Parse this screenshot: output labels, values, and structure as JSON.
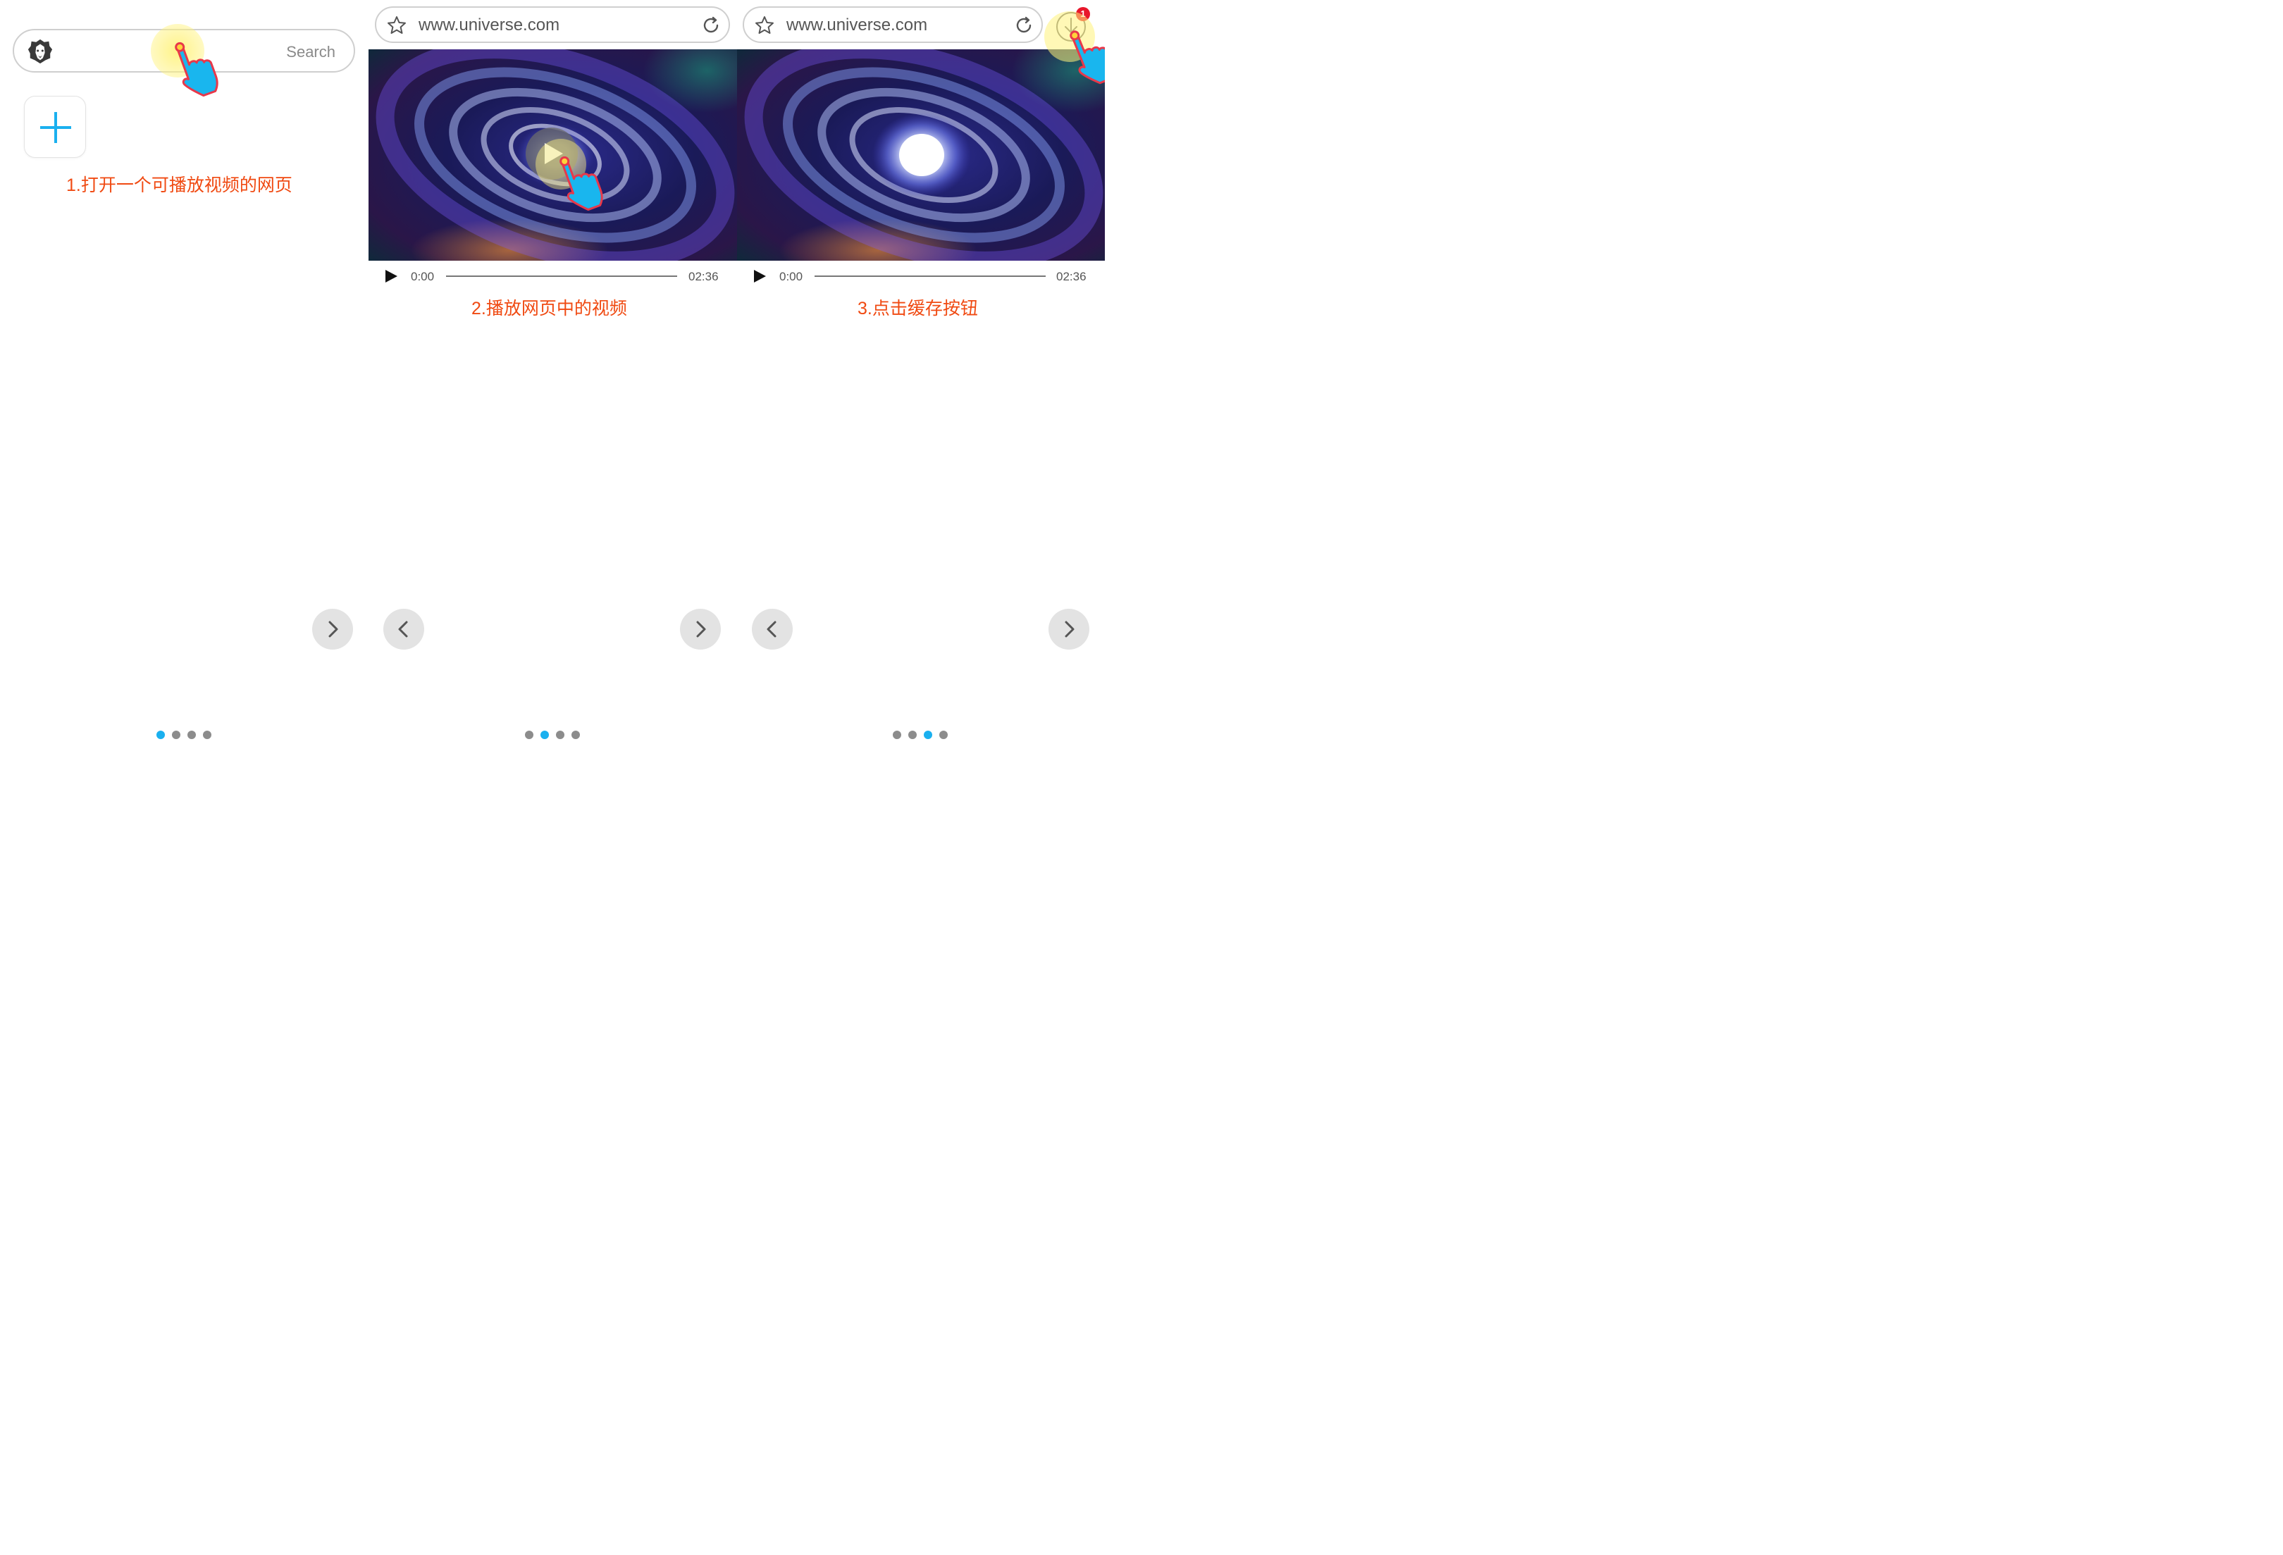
{
  "colors": {
    "accent": "#1ab0ef",
    "caption": "#f04a12",
    "dot_inactive": "#8c8c8c",
    "nav_bg": "#e3e3e3",
    "touch_highlight": "#fff27a"
  },
  "panels": [
    {
      "caption": "1.打开一个可播放视频的网页",
      "search_placeholder": "Search",
      "logo_icon": "lion-logo-icon",
      "add_icon": "plus-icon",
      "page_indicator": {
        "count": 4,
        "active": 0
      }
    },
    {
      "caption": "2.播放网页中的视频",
      "url": "www.universe.com",
      "time_current": "0:00",
      "time_total": "02:36",
      "page_indicator": {
        "count": 4,
        "active": 1
      }
    },
    {
      "caption": "3.点击缓存按钮",
      "url": "www.universe.com",
      "time_current": "0:00",
      "time_total": "02:36",
      "download_badge": "1",
      "page_indicator": {
        "count": 4,
        "active": 2
      }
    }
  ]
}
